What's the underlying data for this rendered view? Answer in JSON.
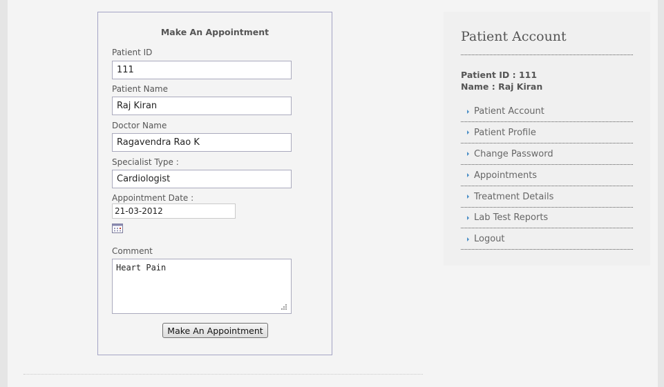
{
  "form": {
    "title": "Make An Appointment",
    "patient_id_label": "Patient ID",
    "patient_id_value": "111",
    "patient_name_label": "Patient Name",
    "patient_name_value": "Raj Kiran",
    "doctor_name_label": "Doctor Name",
    "doctor_name_value": "Ragavendra Rao K",
    "specialist_label": "Specialist Type :",
    "specialist_value": "Cardiologist",
    "date_label": "Appointment Date :",
    "date_value": "21-03-2012",
    "comment_label": "Comment",
    "comment_value": "Heart Pain",
    "submit_label": "Make An Appointment"
  },
  "sidebar": {
    "title": "Patient Account",
    "patient_id_line": "Patient ID : 111",
    "name_line": "Name : Raj Kiran",
    "items": [
      {
        "label": "Patient Account"
      },
      {
        "label": "Patient Profile"
      },
      {
        "label": "Change Password"
      },
      {
        "label": "Appointments"
      },
      {
        "label": "Treatment Details"
      },
      {
        "label": "Lab Test Reports"
      },
      {
        "label": "Logout"
      }
    ]
  },
  "icons": {
    "calendar": "calendar-icon",
    "resize": "resize-grip-icon",
    "menu_bullet": "triangle-right-icon"
  },
  "colors": {
    "page_background": "#f4f4f4",
    "outer_background": "#e5e5e5",
    "form_border": "#a3a3c4",
    "text": "#555555",
    "bullet": "#4a8ec6"
  }
}
